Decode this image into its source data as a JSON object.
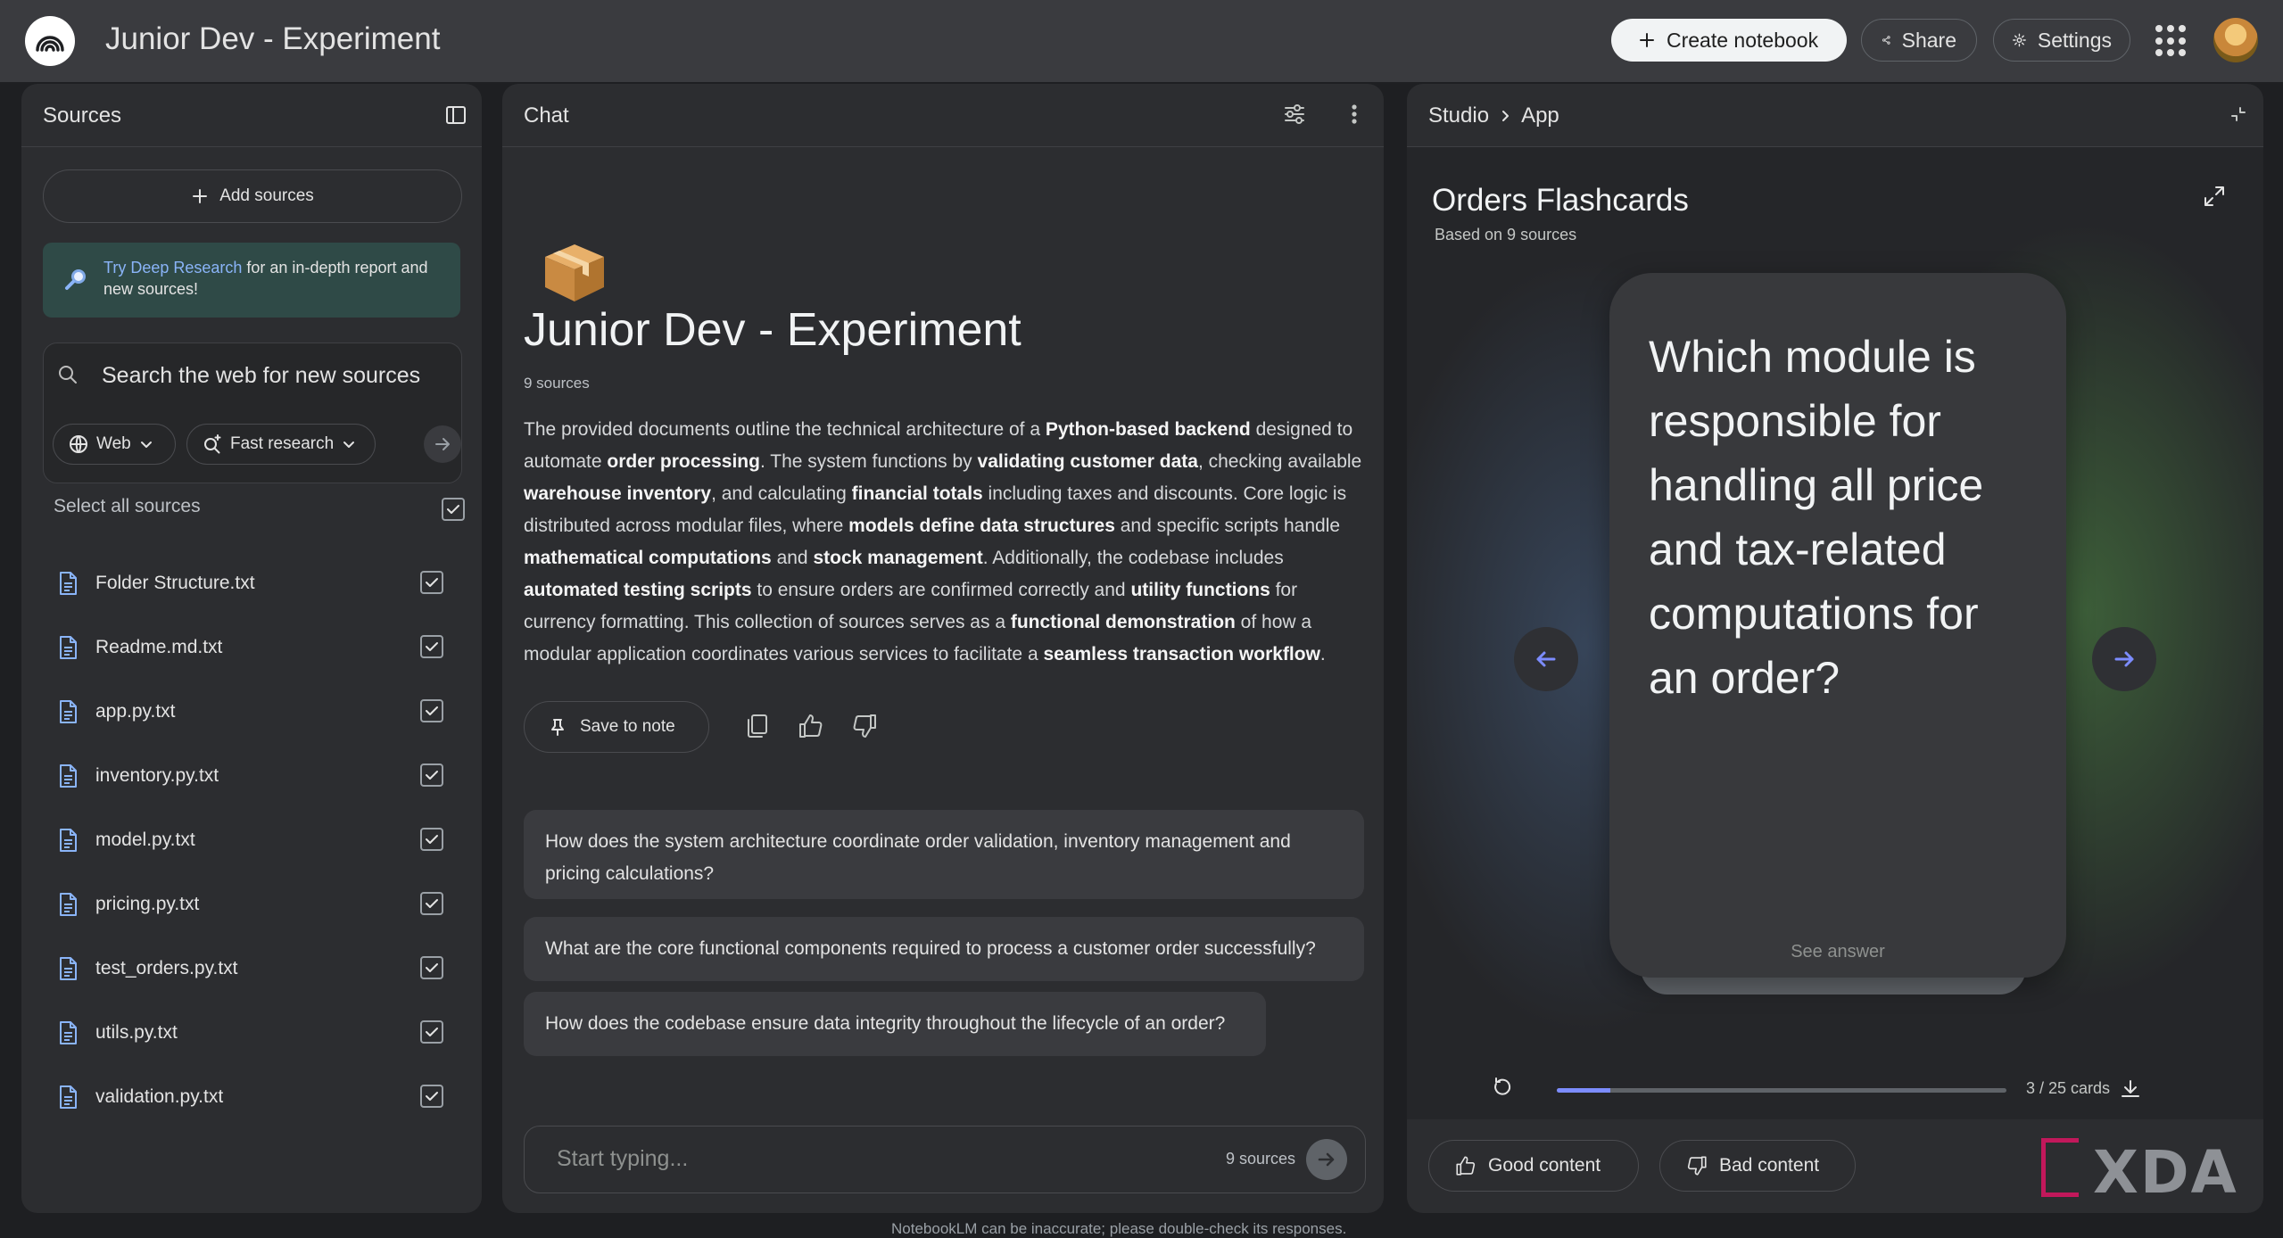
{
  "header": {
    "title": "Junior Dev - Experiment",
    "create_label": "Create notebook",
    "share_label": "Share",
    "settings_label": "Settings"
  },
  "sources": {
    "title": "Sources",
    "add_label": "Add sources",
    "promo_link": "Try Deep Research",
    "promo_text": "for an in-depth report and new sources!",
    "search_placeholder": "Search the web for new sources",
    "web_chip": "Web",
    "research_chip": "Fast research",
    "select_all": "Select all sources",
    "items": [
      {
        "label": "Folder Structure.txt"
      },
      {
        "label": "Readme.md.txt"
      },
      {
        "label": "app.py.txt"
      },
      {
        "label": "inventory.py.txt"
      },
      {
        "label": "model.py.txt"
      },
      {
        "label": "pricing.py.txt"
      },
      {
        "label": "test_orders.py.txt"
      },
      {
        "label": "utils.py.txt"
      },
      {
        "label": "validation.py.txt"
      }
    ]
  },
  "chat": {
    "title": "Chat",
    "notebook_title": "Junior Dev - Experiment",
    "source_count": "9 sources",
    "summary": [
      {
        "t": "The provided documents outline the technical architecture of a ",
        "b": false
      },
      {
        "t": "Python-based backend",
        "b": true
      },
      {
        "t": " designed to automate ",
        "b": false
      },
      {
        "t": "order processing",
        "b": true
      },
      {
        "t": ". The system functions by ",
        "b": false
      },
      {
        "t": "validating customer data",
        "b": true
      },
      {
        "t": ", checking available ",
        "b": false
      },
      {
        "t": "warehouse inventory",
        "b": true
      },
      {
        "t": ", and calculating ",
        "b": false
      },
      {
        "t": "financial totals",
        "b": true
      },
      {
        "t": " including taxes and discounts. Core logic is distributed across modular files, where ",
        "b": false
      },
      {
        "t": "models define data structures",
        "b": true
      },
      {
        "t": " and specific scripts handle ",
        "b": false
      },
      {
        "t": "mathematical computations",
        "b": true
      },
      {
        "t": " and ",
        "b": false
      },
      {
        "t": "stock management",
        "b": true
      },
      {
        "t": ". Additionally, the codebase includes ",
        "b": false
      },
      {
        "t": "automated testing scripts",
        "b": true
      },
      {
        "t": " to ensure orders are confirmed correctly and ",
        "b": false
      },
      {
        "t": "utility functions",
        "b": true
      },
      {
        "t": " for currency formatting. This collection of sources serves as a ",
        "b": false
      },
      {
        "t": "functional demonstration",
        "b": true
      },
      {
        "t": " of how a modular application coordinates various services to facilitate a ",
        "b": false
      },
      {
        "t": "seamless transaction workflow",
        "b": true
      },
      {
        "t": ".",
        "b": false
      }
    ],
    "save_note_label": "Save to note",
    "suggestions": [
      "How does the system architecture coordinate order validation, inventory management and pricing calculations?",
      "What are the core functional components required to process a customer order successfully?",
      "How does the codebase ensure data integrity throughout the lifecycle of an order?"
    ],
    "input_placeholder": "Start typing...",
    "input_sources": "9 sources",
    "disclaimer": "NotebookLM can be inaccurate; please double-check its responses."
  },
  "studio": {
    "crumb_root": "Studio",
    "crumb_current": "App",
    "deck_title": "Orders Flashcards",
    "deck_subtitle": "Based on 9 sources",
    "question": "Which module is responsible for handling all price and tax-related computations for an order?",
    "see_answer": "See answer",
    "progress": {
      "current": 3,
      "total": 25,
      "label": "3 / 25 cards"
    },
    "good_label": "Good content",
    "bad_label": "Bad content"
  },
  "watermark": "XDA",
  "colors": {
    "accent": "#7c8cff",
    "link": "#8ab4f8",
    "promo_bg": "#2f4a47"
  }
}
